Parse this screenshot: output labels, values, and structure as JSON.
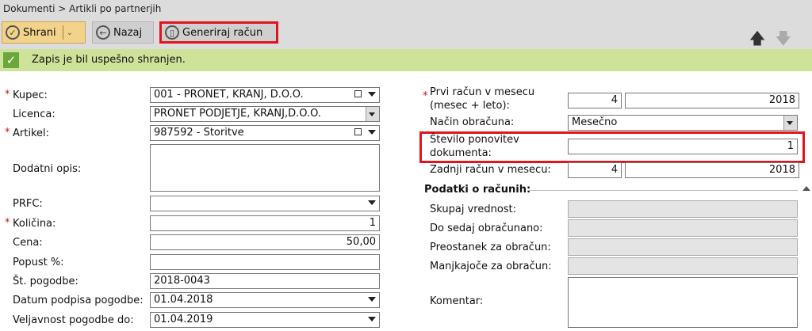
{
  "breadcrumb": "Dokumenti > Artikli po partnerjih",
  "toolbar": {
    "save": "Shrani",
    "back": "Nazaj",
    "generate": "Generiraj račun"
  },
  "success": "Zapis je bil uspešno shranjen.",
  "left": {
    "kupec": {
      "label": "Kupec:",
      "value": "001 - PRONET, KRANJ, D.O.O."
    },
    "licenca": {
      "label": "Licenca:",
      "value": "PRONET PODJETJE, KRANJ,D.O.O."
    },
    "artikel": {
      "label": "Artikel:",
      "value": "987592 - Storitve"
    },
    "opis": {
      "label": "Dodatni opis:",
      "value": ""
    },
    "prfc": {
      "label": "PRFC:",
      "value": ""
    },
    "kolicina": {
      "label": "Količina:",
      "value": "1"
    },
    "cena": {
      "label": "Cena:",
      "value": "50,00"
    },
    "popust": {
      "label": "Popust %:",
      "value": ""
    },
    "pogodba": {
      "label": "Št. pogodbe:",
      "value": "2018-0043"
    },
    "datum": {
      "label": "Datum podpisa pogodbe:",
      "value": "01.04.2018"
    },
    "veljavnost": {
      "label": "Veljavnost pogodbe do:",
      "value": "01.04.2019"
    }
  },
  "right": {
    "prvi": {
      "label1": "Prvi račun v mesecu",
      "label2": "(mesec + leto):",
      "month": "4",
      "year": "2018"
    },
    "nacin": {
      "label": "Način obračuna:",
      "value": "Mesečno"
    },
    "stevilo": {
      "label1": "Število ponovitev",
      "label2": "dokumenta:",
      "value": "1"
    },
    "zadnji": {
      "label": "Zadnji račun v mesecu:",
      "month": "4",
      "year": "2018"
    },
    "section": "Podatki o računih:",
    "skupaj": "Skupaj vrednost:",
    "dosedaj": "Do sedaj obračunano:",
    "preostanek": "Preostanek za obračun:",
    "manjkajoce": "Manjkajoče za obračun:",
    "komentar": "Komentar:"
  },
  "colors": {
    "highlight": "#e0141c",
    "success_bg": "#cfe29a",
    "save_bg": "#f3d28a"
  }
}
